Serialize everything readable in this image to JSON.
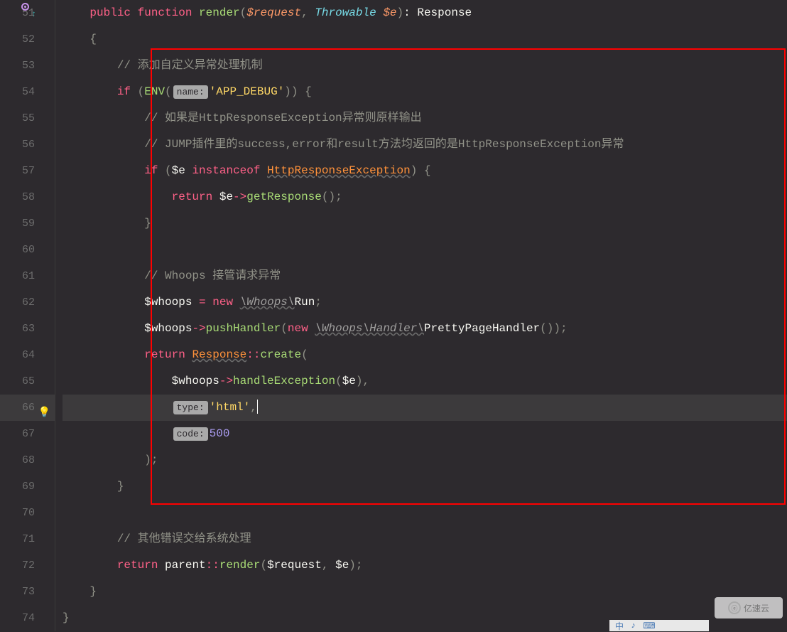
{
  "lines": {
    "start": 51,
    "end": 74
  },
  "code": {
    "l51": {
      "kw_public": "public",
      "kw_function": "function",
      "fn": "render",
      "p1": "$request",
      "comma": ",",
      "type1": "Throwable",
      "p2": "$e",
      "ret": ": Response"
    },
    "l52": {
      "brace": "{"
    },
    "l53": {
      "comment": "// 添加自定义异常处理机制"
    },
    "l54": {
      "kw_if": "if",
      "fn_env": "ENV",
      "hint": "name:",
      "str": "'APP_DEBUG'",
      "close": ")) {"
    },
    "l55": {
      "comment": "// 如果是HttpResponseException异常则原样输出"
    },
    "l56": {
      "comment": "// JUMP插件里的success,error和result方法均返回的是HttpResponseException异常"
    },
    "l57": {
      "kw_if": "if",
      "open": "(",
      "var": "$e",
      "op": "instanceof",
      "cls": "HttpResponseException",
      "close": ") {"
    },
    "l58": {
      "kw_return": "return",
      "var": "$e",
      "arrow": "->",
      "fn": "getResponse",
      "call": "();"
    },
    "l59": {
      "brace": "}"
    },
    "l61": {
      "comment": "// Whoops 接管请求异常"
    },
    "l62": {
      "var": "$whoops",
      "op": "=",
      "kw_new": "new",
      "ns": "\\Whoops\\",
      "cls": "Run",
      "semi": ";"
    },
    "l63": {
      "var": "$whoops",
      "arrow": "->",
      "fn": "pushHandler",
      "kw_new": "new",
      "ns": "\\Whoops\\Handler\\",
      "cls": "PrettyPageHandler",
      "call": "());"
    },
    "l64": {
      "kw_return": "return",
      "cls": "Response",
      "scope": "::",
      "fn": "create",
      "open": "("
    },
    "l65": {
      "var": "$whoops",
      "arrow": "->",
      "fn": "handleException",
      "p": "$e",
      "close": "),"
    },
    "l66": {
      "hint": "type:",
      "str": "'html'",
      "comma": ","
    },
    "l67": {
      "hint": "code:",
      "num": "500"
    },
    "l68": {
      "close": ");"
    },
    "l69": {
      "brace": "}"
    },
    "l71": {
      "comment": "// 其他错误交给系统处理"
    },
    "l72": {
      "kw_return": "return",
      "parent": "parent",
      "scope": "::",
      "fn": "render",
      "p1": "$request",
      "comma": ",",
      "p2": "$e",
      "close": ");"
    },
    "l73": {
      "brace": "}"
    },
    "l74": {
      "brace": "}"
    }
  },
  "watermark": "亿速云",
  "highlighted_line": 66
}
